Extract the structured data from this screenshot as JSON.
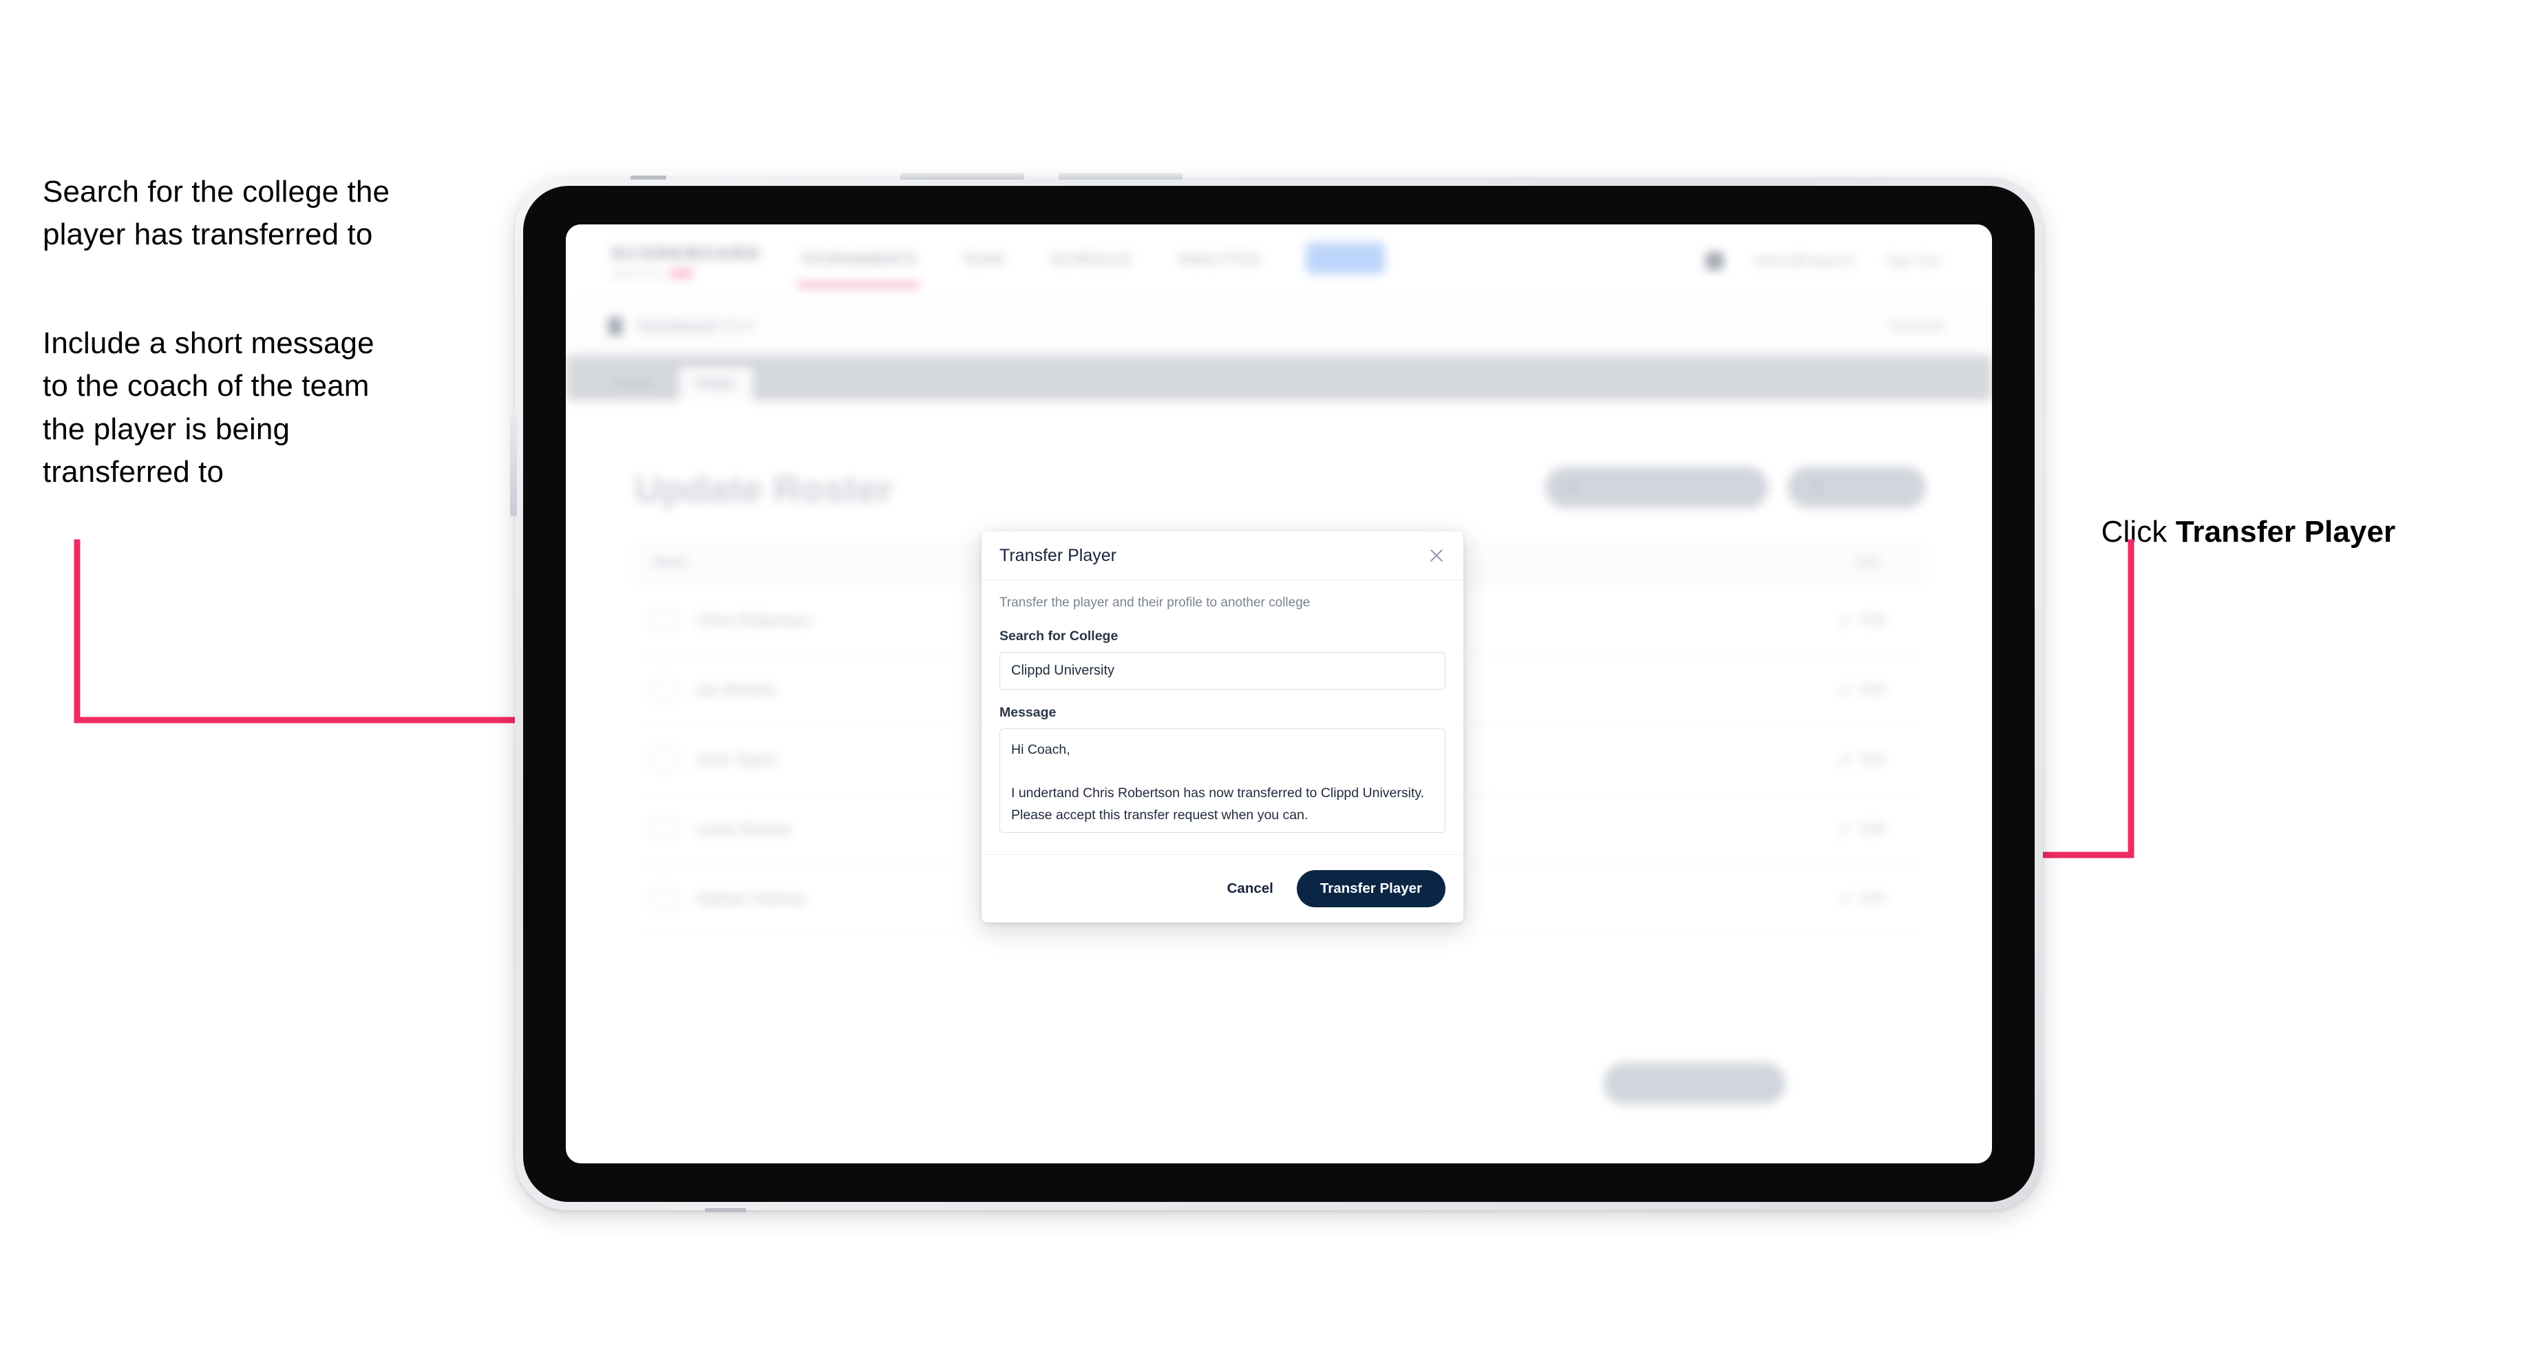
{
  "annotations": {
    "left_1": "Search for the college the\nplayer has transferred to",
    "left_2": "Include a short message\nto the coach of the team\nthe player is being\ntransferred to",
    "right_prefix": "Click ",
    "right_bold": "Transfer Player",
    "arrow_color": "#ee2b63"
  },
  "device": {
    "kind": "tablet",
    "frame_color": "#e6e8ec",
    "bezel_color": "#0a0a0a"
  },
  "app": {
    "brand": {
      "name": "SCOREBOARD",
      "tagline": "powered by"
    },
    "nav": [
      {
        "label": "TOURNAMENTS",
        "active": true
      },
      {
        "label": "TEAM",
        "active": false
      },
      {
        "label": "SCHEDULE",
        "active": false
      },
      {
        "label": "ANALYTICS",
        "active": false
      },
      {
        "label": "ADMIN",
        "active": false,
        "chip": true
      }
    ],
    "nav_right": {
      "user_email": "admin@clippd.io",
      "sign_out": "Sign Out"
    },
    "breadcrumb": {
      "title": "Scoreboard",
      "subtitle": "2024",
      "right_action": "General"
    },
    "tab_strip": [
      {
        "label": "Details",
        "selected": false
      },
      {
        "label": "Roster",
        "selected": true
      }
    ],
    "page_title": "Update Roster",
    "page_actions": [
      {
        "label": "Request Player Transfer",
        "icon": "user-swap-icon"
      },
      {
        "label": "Add Player",
        "icon": "plus-icon"
      }
    ],
    "roster": {
      "columns": {
        "name": "Name",
        "edit": "Edit"
      },
      "rows": [
        {
          "name": "Chris Robertson",
          "action": "Edit"
        },
        {
          "name": "Ian Winters",
          "action": "Edit"
        },
        {
          "name": "John Taylor",
          "action": "Edit"
        },
        {
          "name": "Lewis Barnes",
          "action": "Edit"
        },
        {
          "name": "Nathan Holmes",
          "action": "Edit"
        }
      ]
    },
    "save_button": "Save And Continue"
  },
  "modal": {
    "title": "Transfer Player",
    "close_icon": "close-icon",
    "description": "Transfer the player and their profile to another college",
    "college_label": "Search for College",
    "college_value": "Clippd University",
    "college_placeholder": "Search for College",
    "message_label": "Message",
    "message_value": "Hi Coach,\n\nI undertand Chris Robertson has now transferred to Clippd University. Please accept this transfer request when you can.",
    "message_placeholder": "Message",
    "cancel_label": "Cancel",
    "submit_label": "Transfer Player",
    "submit_color": "#0b2545"
  }
}
